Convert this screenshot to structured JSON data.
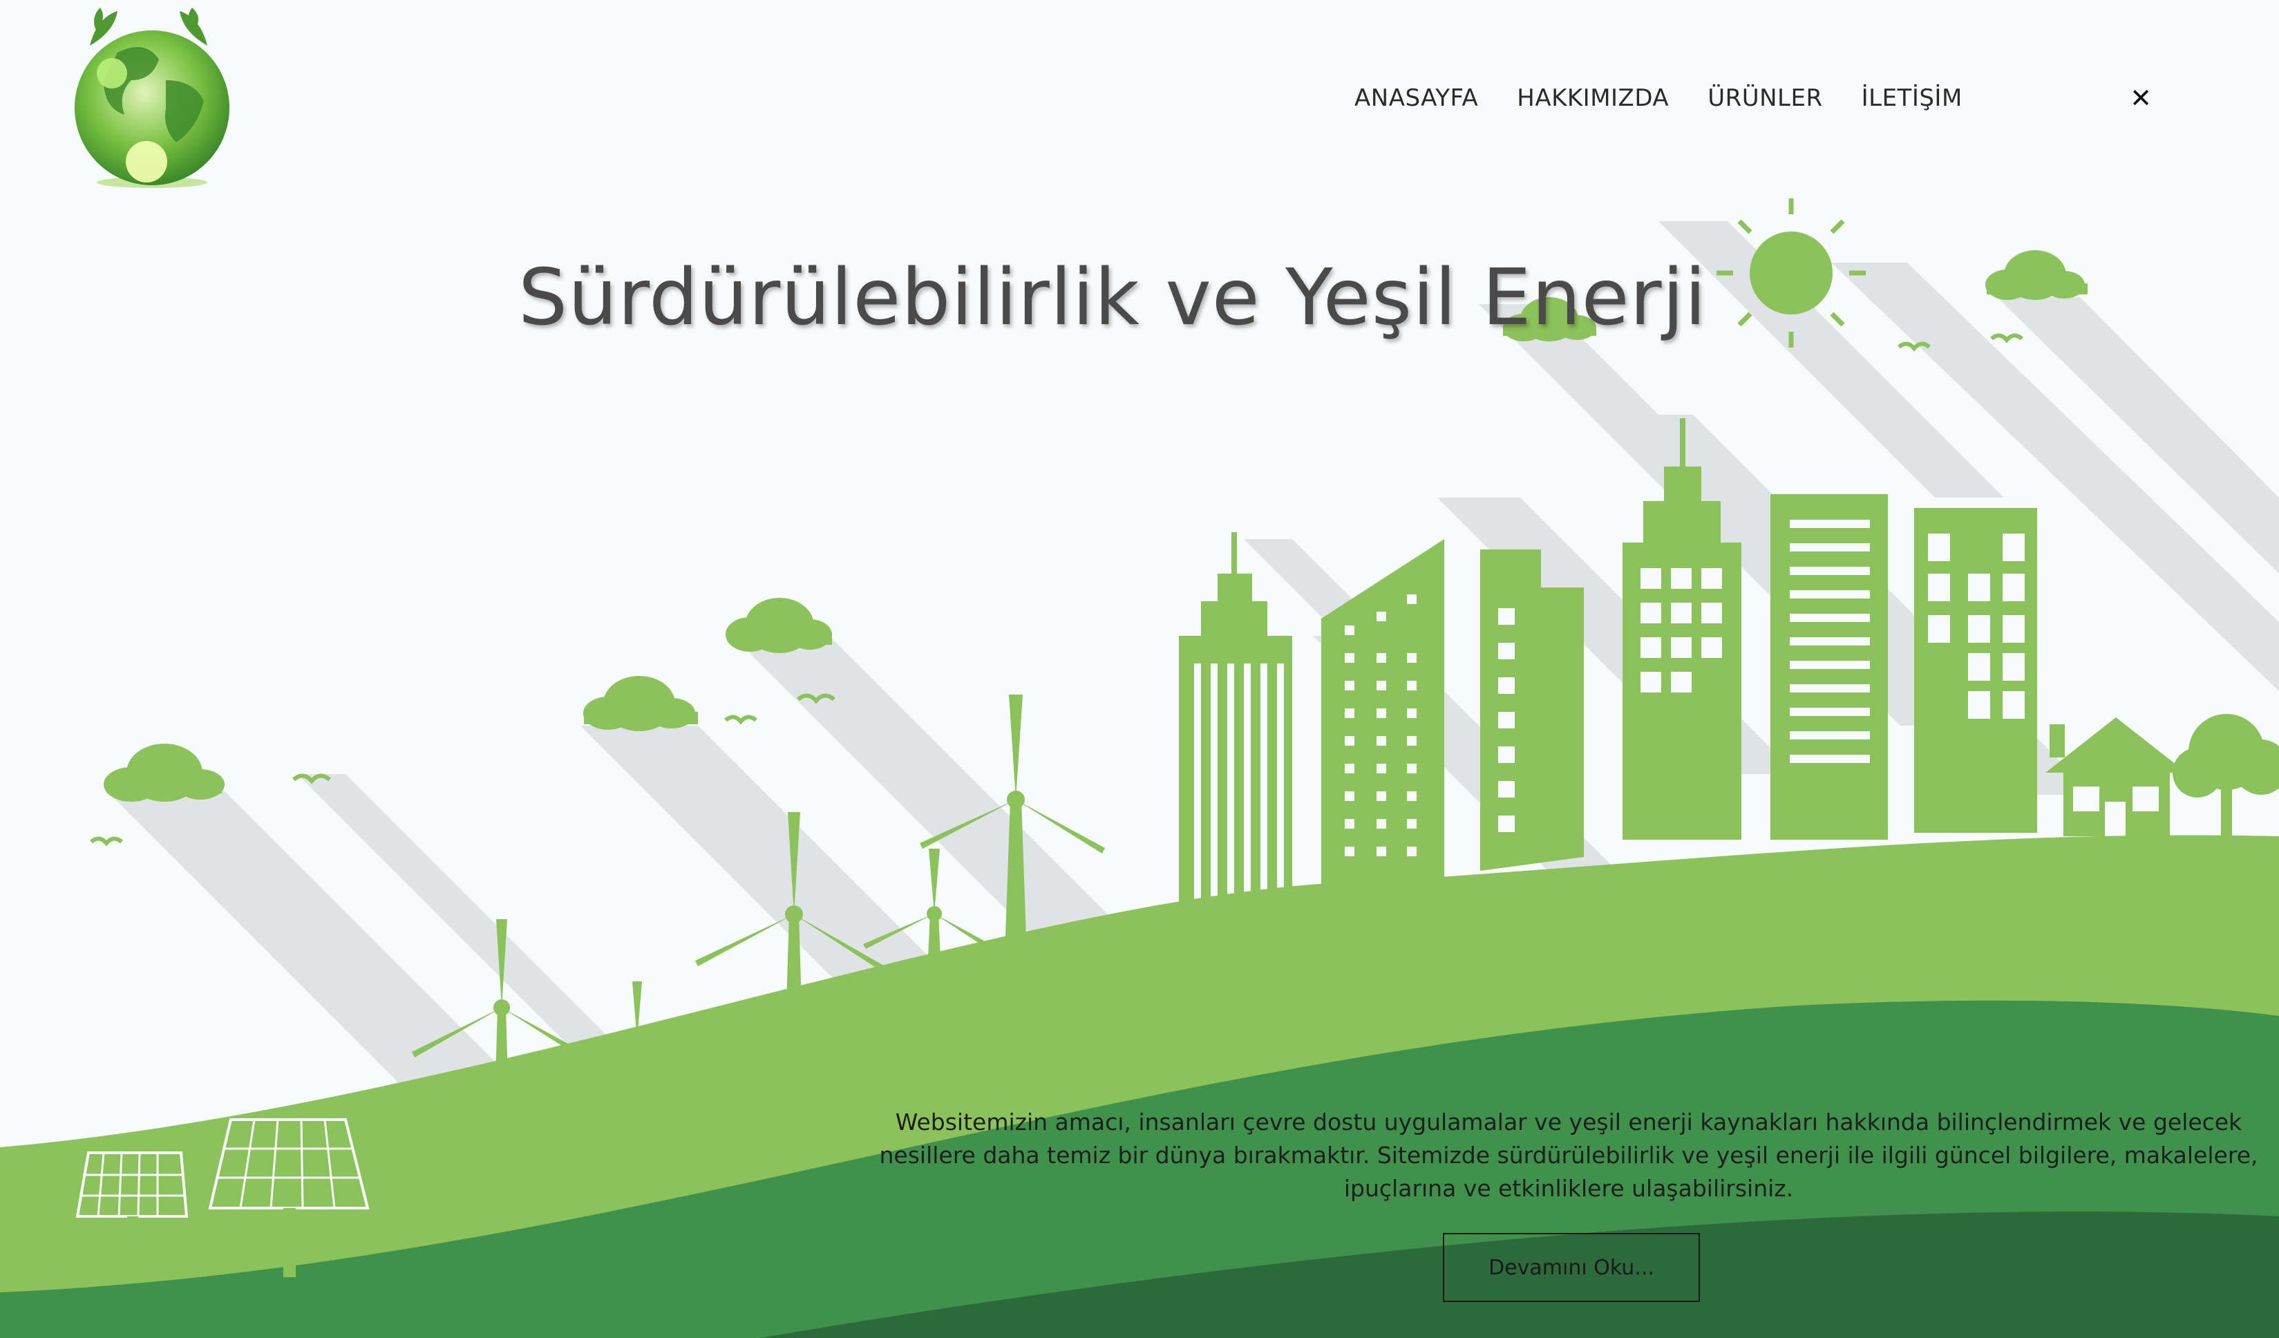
{
  "nav": {
    "items": [
      {
        "label": "ANASAYFA"
      },
      {
        "label": "HAKKIMIZDA"
      },
      {
        "label": "ÜRÜNLER"
      },
      {
        "label": "İLETİŞİM"
      }
    ],
    "close_label": "✕"
  },
  "hero": {
    "title": "Sürdürülebilirlik ve Yeşil Enerji",
    "intro": "Websitemizin amacı, insanları çevre dostu uygulamalar ve yeşil enerji kaynakları hakkında bilinçlendirmek ve gelecek nesillere daha temiz bir dünya bırakmaktır. Sitemizde sürdürülebilirlik ve yeşil enerji ile ilgili güncel bilgilere, makalelere, ipuçlarına ve etkinliklere ulaşabilirsiniz.",
    "button_label": "Devamını Oku..."
  },
  "colors": {
    "light_green": "#8bc25a",
    "mid_green": "#3f914c",
    "dark_green": "#2c6a3c",
    "shadow_gray": "#dfe3e5",
    "background": "#f7fbfc"
  },
  "icons": [
    "globe-logo-icon",
    "close-icon",
    "sun-icon",
    "cloud-icon",
    "bird-icon",
    "wind-turbine-icon",
    "solar-panel-icon",
    "house-icon",
    "tree-icon"
  ]
}
